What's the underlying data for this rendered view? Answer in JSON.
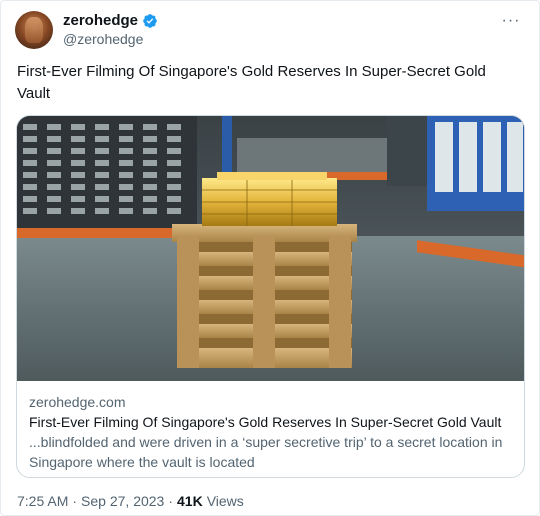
{
  "author": {
    "display_name": "zerohedge",
    "handle": "@zerohedge",
    "avatar_icon": "profile-photo",
    "verified_icon": "verified-badge-icon",
    "verified_color": "#1d9bf0"
  },
  "more_label": "···",
  "tweet_text": "First-Ever Filming Of Singapore's Gold Reserves In Super-Secret Gold Vault",
  "card": {
    "image_icon": "gold-bars-on-pallets-image",
    "domain": "zerohedge.com",
    "title": "First-Ever Filming Of Singapore's Gold Reserves In Super-Secret Gold Vault",
    "description": "...blindfolded and were driven in a ‘super secretive trip’ to a secret location in Singapore where the vault is located"
  },
  "footer": {
    "time": "7:25 AM",
    "separator": "·",
    "date": "Sep 27, 2023",
    "separator2": "·",
    "views_count": "41K",
    "views_label": "Views"
  }
}
